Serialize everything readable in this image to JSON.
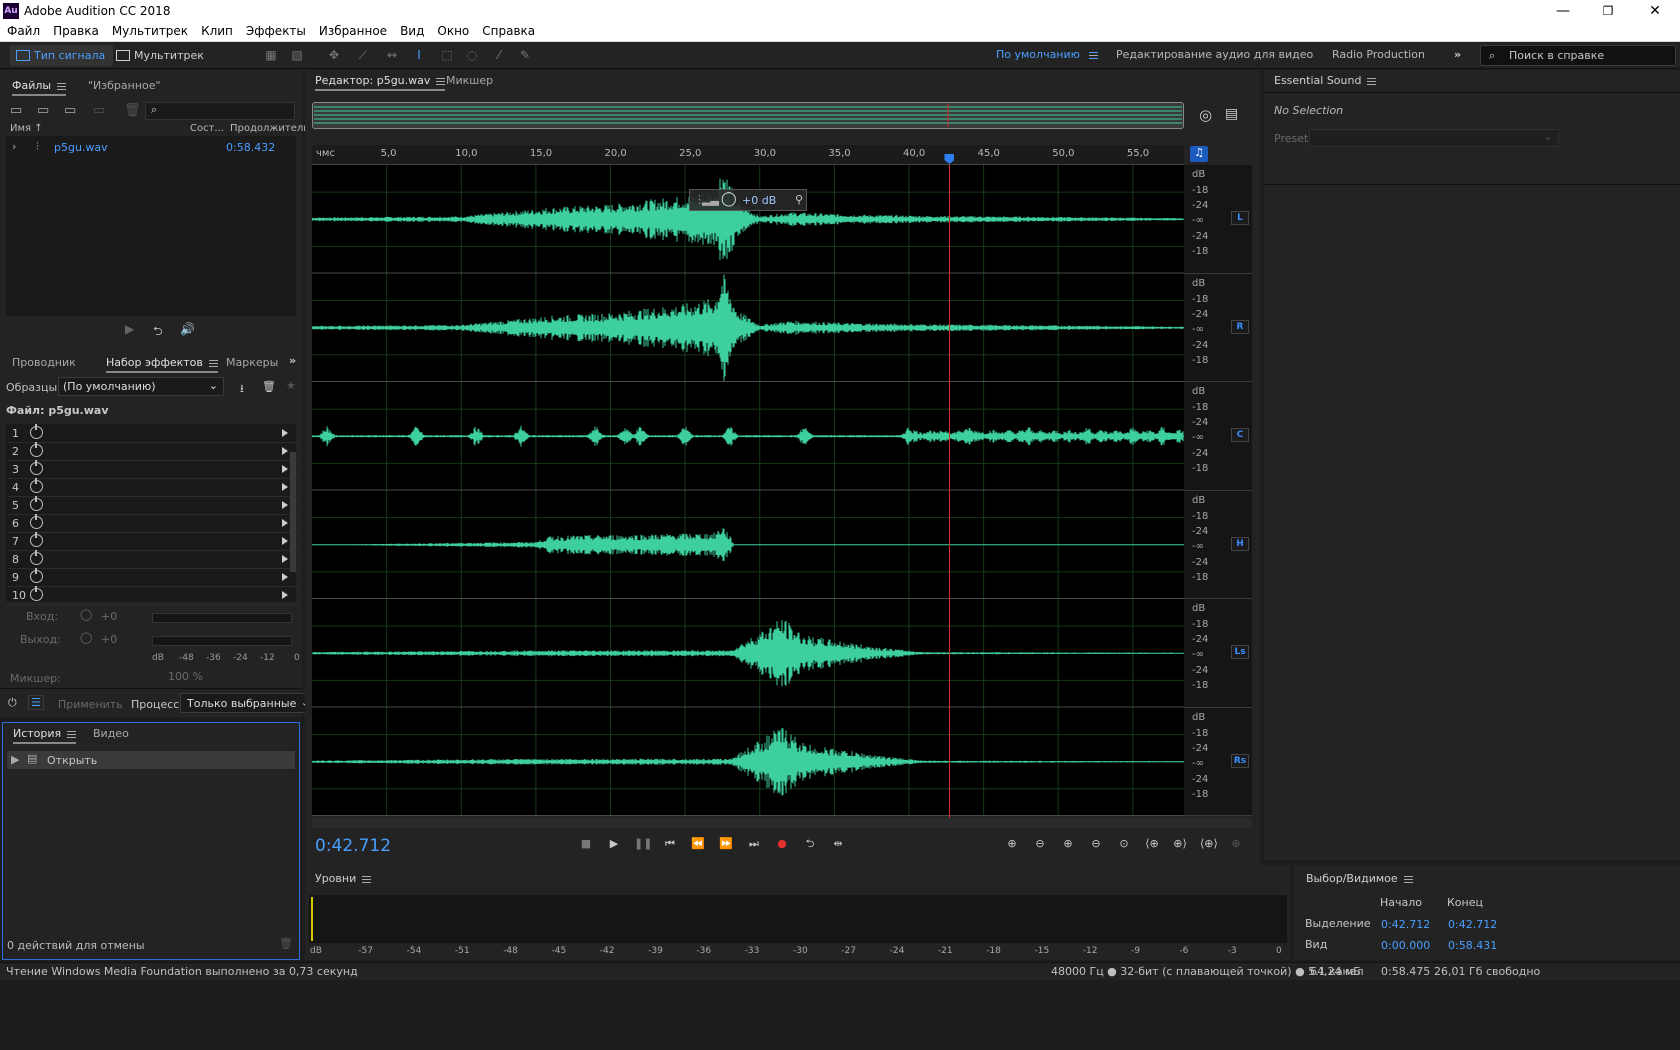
{
  "app": {
    "title": "Adobe Audition CC 2018",
    "logo": "Au",
    "window_controls": [
      "minimize-icon",
      "restore-icon",
      "close-icon"
    ]
  },
  "menu": [
    "Файл",
    "Правка",
    "Мультитрек",
    "Клип",
    "Эффекты",
    "Избранное",
    "Вид",
    "Окно",
    "Справка"
  ],
  "toolbar": {
    "waveform_label": "Тип сигнала",
    "multitrack_label": "Мультитрек",
    "workspaces": [
      "По умолчанию",
      "Редактирование аудио для видео",
      "Radio Production"
    ],
    "active_workspace": "По умолчанию",
    "help_placeholder": "Поиск в справке"
  },
  "files_panel": {
    "tabs": [
      "Файлы",
      "\"Избранное\""
    ],
    "col_name": "Имя",
    "col_state": "Сост...",
    "col_duration": "Продолжительн.",
    "file_name": "p5gu.wav",
    "file_duration": "0:58.432"
  },
  "effects_panel": {
    "tabs": [
      "Проводник",
      "Набор эффектов",
      "Маркеры"
    ],
    "presets_label": "Образцы:",
    "preset_value": "(По умолчанию)",
    "file_label": "Файл: p5gu.wav",
    "slots": [
      "1",
      "2",
      "3",
      "4",
      "5",
      "6",
      "7",
      "8",
      "9",
      "10"
    ],
    "input_label": "Вход:",
    "input_value": "+0",
    "output_label": "Выход:",
    "output_value": "+0",
    "meter_ticks": [
      "dB",
      "-48",
      "-36",
      "-24",
      "-12",
      "0"
    ],
    "mixer_label": "Микшер:",
    "mixer_value": "100 %",
    "apply_label": "Применить",
    "process_label": "Процесс:",
    "process_value": "Только выбранные"
  },
  "history_panel": {
    "tabs": [
      "История",
      "Видео"
    ],
    "item": "Открыть",
    "footer": "0 действий для отмены"
  },
  "editor": {
    "tabs": [
      "Редактор: p5gu.wav",
      "Микшер"
    ],
    "ruler_unit": "чмс",
    "ruler_labels": [
      "5,0",
      "10,0",
      "15,0",
      "20,0",
      "25,0",
      "30,0",
      "35,0",
      "40,0",
      "45,0",
      "50,0",
      "55,0"
    ],
    "db_labels": [
      "dB",
      "-18",
      "-24",
      "-∞",
      "-24",
      "-18"
    ],
    "channels": [
      "L",
      "R",
      "C",
      "LFE",
      "Ls",
      "Rs"
    ],
    "hud_gain": "+0 dB",
    "time": "0:42.712",
    "playhead_seconds": 42.712,
    "total_seconds": 58.432,
    "wave_color": "#3ecf9e",
    "playhead_color": "#d92b2b"
  },
  "levels": {
    "title": "Уровни",
    "ticks": [
      "dB",
      "-57",
      "-54",
      "-51",
      "-48",
      "-45",
      "-42",
      "-39",
      "-36",
      "-33",
      "-30",
      "-27",
      "-24",
      "-21",
      "-18",
      "-15",
      "-12",
      "-9",
      "-6",
      "-3",
      "0"
    ]
  },
  "essential_sound": {
    "title": "Essential Sound",
    "no_selection": "No Selection",
    "preset_label": "Preset:"
  },
  "selection_view": {
    "title": "Выбор/Видимое",
    "col_start": "Начало",
    "col_end": "Конец",
    "selection_label": "Выделение",
    "selection_start": "0:42.712",
    "selection_end": "0:42.712",
    "view_label": "Вид",
    "view_start": "0:00.000",
    "view_end": "0:58.431"
  },
  "status": {
    "message": "Чтение Windows Media Foundation выполнено за 0,73 секунд",
    "format": "48000 Гц ● 32-бит (с плавающей точкой) ● 5.1 канал",
    "size": "64,24 мБ",
    "duration": "0:58.475",
    "free": "26,01 Гб свободно"
  }
}
